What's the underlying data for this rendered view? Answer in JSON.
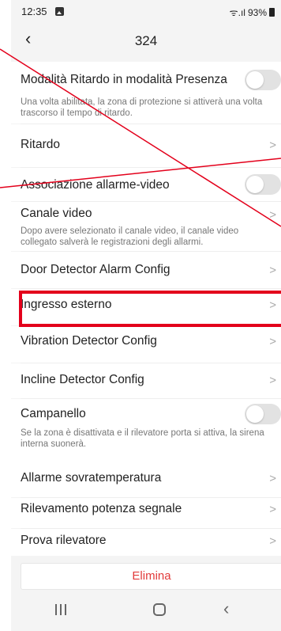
{
  "status_bar": {
    "time": "12:35",
    "wifi_signal": "ᯤ.ıl",
    "battery": "93%"
  },
  "header": {
    "title": "324",
    "back_icon": "chevron-left-icon"
  },
  "settings": {
    "delay_presence": {
      "label": "Modalità Ritardo in modalità Presenza",
      "description": "Una volta abilitata, la zona di protezione si attiverà una volta trascorso il tempo di ritardo.",
      "toggle_on": false
    },
    "delay": {
      "label": "Ritardo"
    },
    "alarm_video": {
      "label": "Associazione allarme-video",
      "toggle_on": false
    },
    "video_channel": {
      "label": "Canale video",
      "description": "Dopo avere selezionato il canale video, il canale video collegato salverà le registrazioni degli allarmi."
    },
    "door_detector": {
      "label": "Door Detector Alarm Config"
    },
    "external_input": {
      "label": "Ingresso esterno"
    },
    "vibration_detector": {
      "label": "Vibration Detector Config"
    },
    "incline_detector": {
      "label": "Incline Detector Config"
    },
    "doorbell": {
      "label": "Campanello",
      "description": "Se la zona è disattivata e il rilevatore porta si attiva, la sirena interna suonerà.",
      "toggle_on": false
    },
    "over_temperature": {
      "label": "Allarme sovratemperatura"
    },
    "signal_strength": {
      "label": "Rilevamento potenza segnale"
    },
    "test_detector": {
      "label": "Prova rilevatore"
    }
  },
  "actions": {
    "delete_label": "Elimina"
  },
  "chevron": ">",
  "colors": {
    "delete_red": "#e23b3b",
    "annotation_red": "#e3001b",
    "toggle_off": "#e2e2e2"
  }
}
